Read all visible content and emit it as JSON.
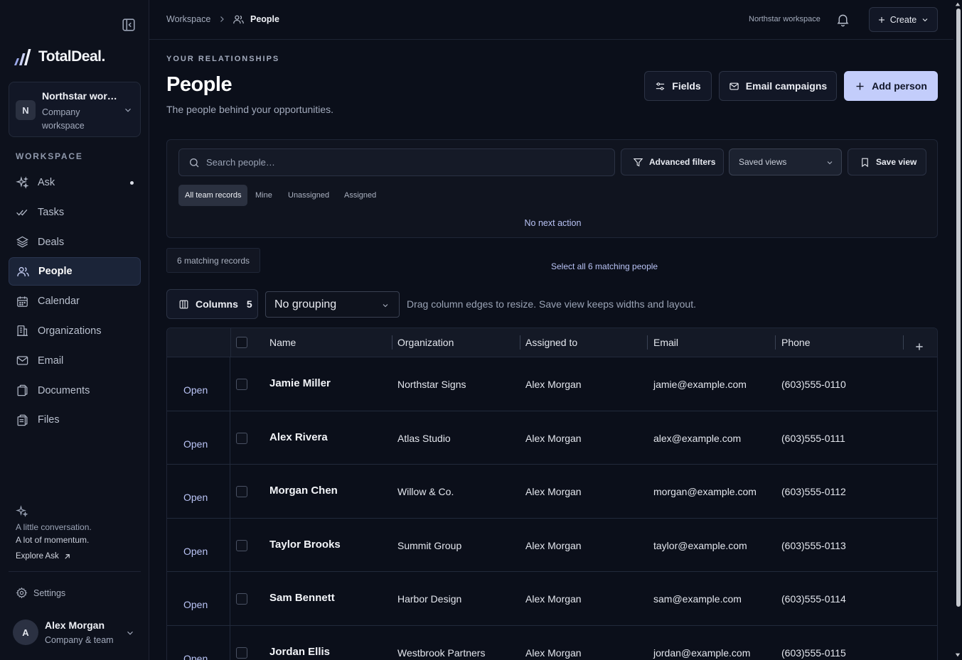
{
  "brand": {
    "name": "TotalDeal."
  },
  "workspace_card": {
    "avatar": "N",
    "name": "Northstar wor…",
    "sub": "Company workspace"
  },
  "sidebar": {
    "section_label": "WORKSPACE",
    "items": [
      {
        "label": "Ask",
        "icon": "sparkles-icon"
      },
      {
        "label": "Tasks",
        "icon": "checks-icon"
      },
      {
        "label": "Deals",
        "icon": "layers-icon"
      },
      {
        "label": "People",
        "icon": "users-icon",
        "active": true
      },
      {
        "label": "Calendar",
        "icon": "calendar-icon"
      },
      {
        "label": "Organizations",
        "icon": "building-icon"
      },
      {
        "label": "Email",
        "icon": "mail-icon"
      },
      {
        "label": "Documents",
        "icon": "documents-icon"
      },
      {
        "label": "Files",
        "icon": "files-icon"
      }
    ],
    "promo": {
      "line1": "A little conversation.",
      "line2": "A lot of momentum.",
      "link": "Explore Ask"
    },
    "settings_label": "Settings",
    "user": {
      "avatar": "A",
      "name": "Alex Morgan",
      "sub": "Company & team"
    }
  },
  "topbar": {
    "breadcrumb_root": "Workspace",
    "breadcrumb_current": "People",
    "workspace_label": "Northstar workspace",
    "create_label": "Create"
  },
  "header": {
    "eyebrow": "YOUR RELATIONSHIPS",
    "title": "People",
    "subtitle": "The people behind your opportunities.",
    "fields_label": "Fields",
    "email_campaigns_label": "Email campaigns",
    "add_person_label": "Add person"
  },
  "filters": {
    "search_placeholder": "Search people…",
    "advanced_label": "Advanced filters",
    "saved_views_label": "Saved views",
    "save_view_label": "Save view",
    "segments": [
      "All team records",
      "Mine",
      "Unassigned",
      "Assigned"
    ],
    "active_segment": "All team records",
    "no_next_action": "No next action"
  },
  "results": {
    "matching_label": "6 matching records",
    "select_all_label": "Select all 6 matching people"
  },
  "toolbar": {
    "columns_label": "Columns",
    "columns_count": "5",
    "grouping_value": "No grouping",
    "drag_hint": "Drag column edges to resize. Save view keeps widths and layout."
  },
  "table": {
    "columns": [
      "Name",
      "Organization",
      "Assigned to",
      "Email",
      "Phone"
    ],
    "open_label": "Open",
    "rows": [
      {
        "name": "Jamie Miller",
        "organization": "Northstar Signs",
        "assigned": "Alex Morgan",
        "email": "jamie@example.com",
        "phone": "(603)555-0110"
      },
      {
        "name": "Alex Rivera",
        "organization": "Atlas Studio",
        "assigned": "Alex Morgan",
        "email": "alex@example.com",
        "phone": "(603)555-0111"
      },
      {
        "name": "Morgan Chen",
        "organization": "Willow & Co.",
        "assigned": "Alex Morgan",
        "email": "morgan@example.com",
        "phone": "(603)555-0112"
      },
      {
        "name": "Taylor Brooks",
        "organization": "Summit Group",
        "assigned": "Alex Morgan",
        "email": "taylor@example.com",
        "phone": "(603)555-0113"
      },
      {
        "name": "Sam Bennett",
        "organization": "Harbor Design",
        "assigned": "Alex Morgan",
        "email": "sam@example.com",
        "phone": "(603)555-0114"
      },
      {
        "name": "Jordan Ellis",
        "organization": "Westbrook Partners",
        "assigned": "Alex Morgan",
        "email": "jordan@example.com",
        "phone": "(603)555-0115"
      }
    ]
  },
  "colors": {
    "accent": "#c3cdfb",
    "link": "#bac4f6",
    "background": "#0b0f1a"
  }
}
